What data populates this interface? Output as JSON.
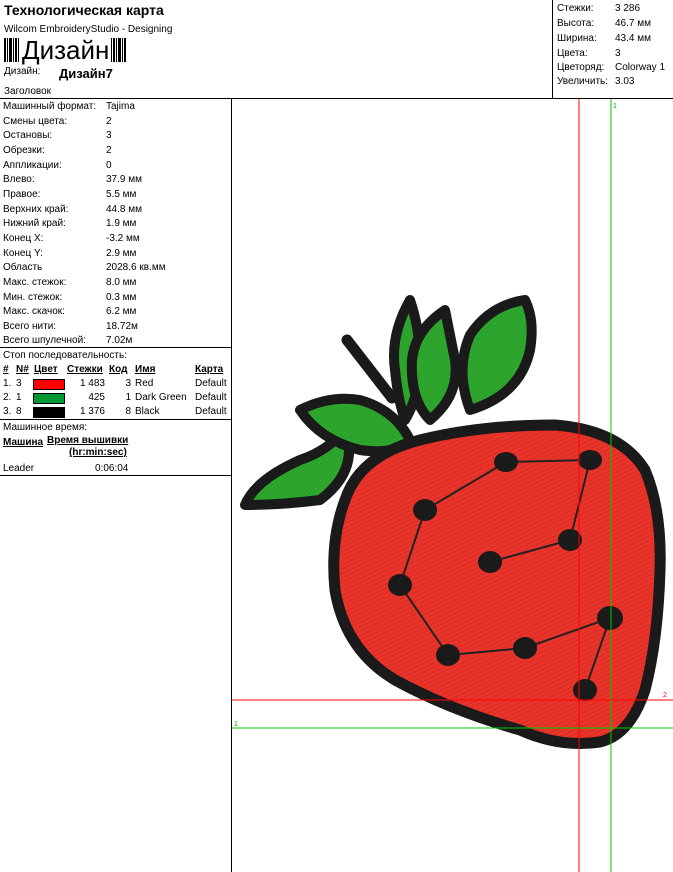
{
  "header": {
    "title": "Технологическая карта",
    "subtitle": "Wilcom EmbroideryStudio - Designing",
    "barcode_text": "Дизайн",
    "design_label": "Дизайн:",
    "design_value": "Дизайн7",
    "header_label": "Заголовок"
  },
  "stats": [
    {
      "label": "Стежки:",
      "value": "3 286"
    },
    {
      "label": "Высота:",
      "value": "46.7 мм"
    },
    {
      "label": "Ширина:",
      "value": "43.4 мм"
    },
    {
      "label": "Цвета:",
      "value": "3"
    },
    {
      "label": "Цветоряд:",
      "value": "Colorway 1"
    },
    {
      "label": "Увеличить:",
      "value": "3.03"
    }
  ],
  "properties": [
    {
      "label": "Машинный формат:",
      "value": "Tajima"
    },
    {
      "label": "Смены цвета:",
      "value": "2"
    },
    {
      "label": "Остановы:",
      "value": "3"
    },
    {
      "label": "Обрезки:",
      "value": "2"
    },
    {
      "label": "Аппликации:",
      "value": "0"
    },
    {
      "label": "Влево:",
      "value": "37.9 мм"
    },
    {
      "label": "Правое:",
      "value": "5.5 мм"
    },
    {
      "label": "Верхних край:",
      "value": "44.8 мм"
    },
    {
      "label": "Нижний край:",
      "value": "1.9 мм"
    },
    {
      "label": "Конец X:",
      "value": "-3.2 мм"
    },
    {
      "label": "Конец Y:",
      "value": "2.9 мм"
    },
    {
      "label": "Область",
      "value": "2028.6 кв.мм"
    },
    {
      "label": "Макс. стежок:",
      "value": "8.0 мм"
    },
    {
      "label": "Мин. стежок:",
      "value": "0.3 мм"
    },
    {
      "label": "Макс. скачок:",
      "value": "6.2 мм"
    },
    {
      "label": "Всего нити:",
      "value": "18.72м"
    },
    {
      "label": "Всего шпулечной:",
      "value": "7.02м"
    }
  ],
  "sequence": {
    "title": "Стоп последовательность:",
    "columns": {
      "num": "#",
      "n": "N#",
      "color": "Цвет",
      "stitches": "Стежки",
      "code": "Код",
      "name": "Имя",
      "chart": "Карта"
    },
    "rows": [
      {
        "num": "1.",
        "n": "3",
        "color": "#ff0000",
        "stitches": "1 483",
        "code": "3",
        "name": "Red",
        "chart": "Default"
      },
      {
        "num": "2.",
        "n": "1",
        "color": "#009933",
        "stitches": "425",
        "code": "1",
        "name": "Dark Green",
        "chart": "Default"
      },
      {
        "num": "3.",
        "n": "8",
        "color": "#000000",
        "stitches": "1 376",
        "code": "8",
        "name": "Black",
        "chart": "Default"
      }
    ]
  },
  "machine_time": {
    "title": "Машинное время:",
    "col_machine": "Машина",
    "col_time": "Время вышивки",
    "col_time_unit": "(hr:min:sec)",
    "rows": [
      {
        "machine": "Leader",
        "time": "0:06:04"
      }
    ]
  },
  "canvas_markers": {
    "top_marker": "1",
    "right_marker": "2",
    "left_marker": "1"
  },
  "colors": {
    "berry": "#e8342a",
    "leaf": "#2ea82e",
    "outline": "#1a1a1a",
    "guide_red": "#ff0000",
    "guide_green": "#00cc00"
  }
}
